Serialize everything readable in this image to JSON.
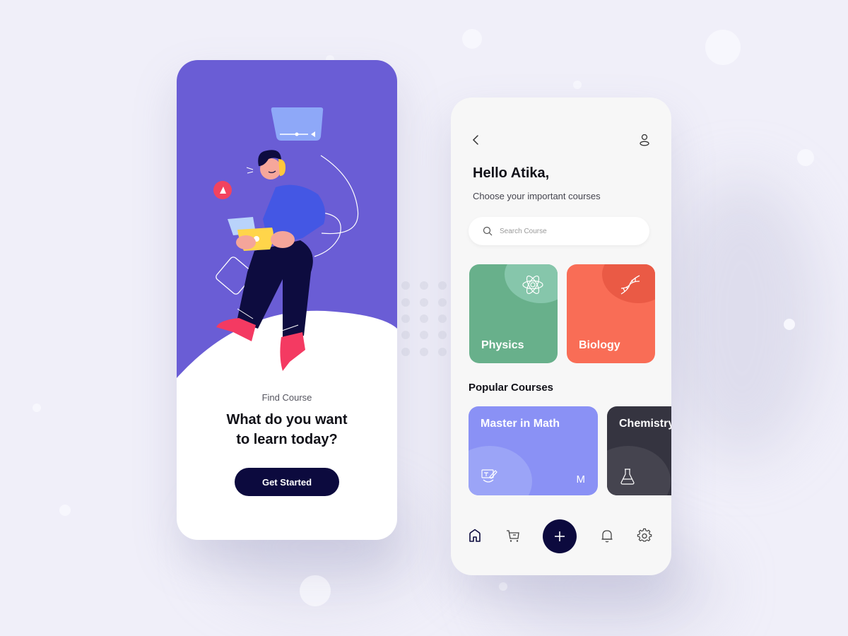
{
  "colors": {
    "background": "#f0eff9",
    "hero_purple": "#6a5dd5",
    "dark_navy": "#0c0a3e",
    "physics_green": "#68b08b",
    "biology_coral": "#f96d56",
    "math_periwinkle": "#8a91f5",
    "chemistry_dark": "#353440"
  },
  "onboarding": {
    "eyebrow": "Find Course",
    "headline_line1": "What do you want",
    "headline_line2": "to learn today?",
    "cta_label": "Get Started"
  },
  "home": {
    "back_icon": "chevron-left-icon",
    "profile_icon": "user-icon",
    "greeting": "Hello Atika,",
    "subtitle": "Choose your important courses",
    "search": {
      "placeholder": "Search Course",
      "value": "",
      "icon": "search-icon"
    },
    "categories": [
      {
        "label": "Physics",
        "icon": "atom-icon",
        "color": "#68b08b"
      },
      {
        "label": "Biology",
        "icon": "dna-icon",
        "color": "#f96d56"
      }
    ],
    "popular_title": "Popular Courses",
    "popular": [
      {
        "label": "Master in Math",
        "icon": "drafting-icon",
        "badge": "M",
        "color": "#8a91f5"
      },
      {
        "label": "Chemistry",
        "icon": "flask-icon",
        "badge": "",
        "color": "#353440"
      }
    ],
    "nav": [
      {
        "name": "home",
        "icon": "home-icon",
        "active": true
      },
      {
        "name": "cart",
        "icon": "cart-icon",
        "active": false
      },
      {
        "name": "add",
        "icon": "plus-icon",
        "active": false
      },
      {
        "name": "notifications",
        "icon": "bell-icon",
        "active": false
      },
      {
        "name": "settings",
        "icon": "gear-icon",
        "active": false
      }
    ]
  }
}
